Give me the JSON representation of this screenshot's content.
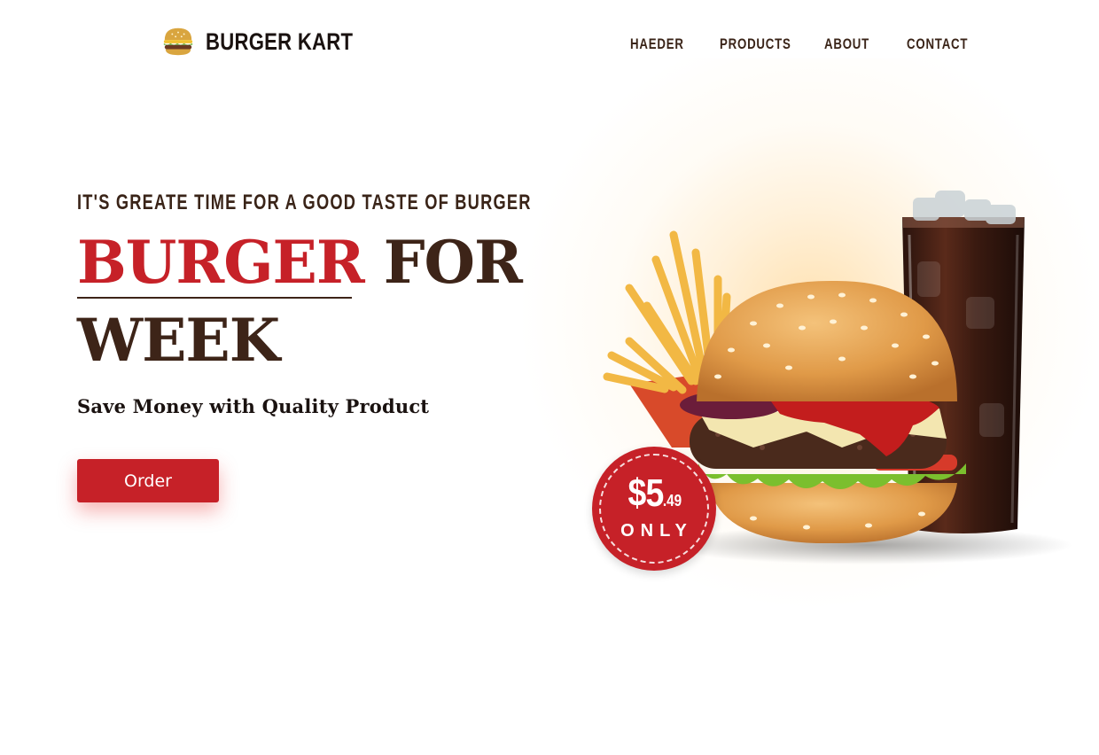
{
  "brand": {
    "name": "BURGER KART",
    "logo_icon": "burger-icon"
  },
  "nav": {
    "items": [
      {
        "label": "HAEDER"
      },
      {
        "label": "PRODUCTS"
      },
      {
        "label": "ABOUT"
      },
      {
        "label": "CONTACT"
      }
    ]
  },
  "hero": {
    "eyebrow": "IT'S GREATE TIME FOR A GOOD TASTE OF BURGER",
    "title_red": "BURGER",
    "title_brown_1": "FOR",
    "title_brown_2": "WEEK",
    "subtitle": "Save Money with Quality Product",
    "order_label": "Order"
  },
  "price_badge": {
    "dollars": "$5",
    "cents": ".49",
    "note": "ONLY"
  },
  "colors": {
    "accent_red": "#c62128",
    "brown": "#3d2418",
    "dark_text": "#1a1210"
  }
}
